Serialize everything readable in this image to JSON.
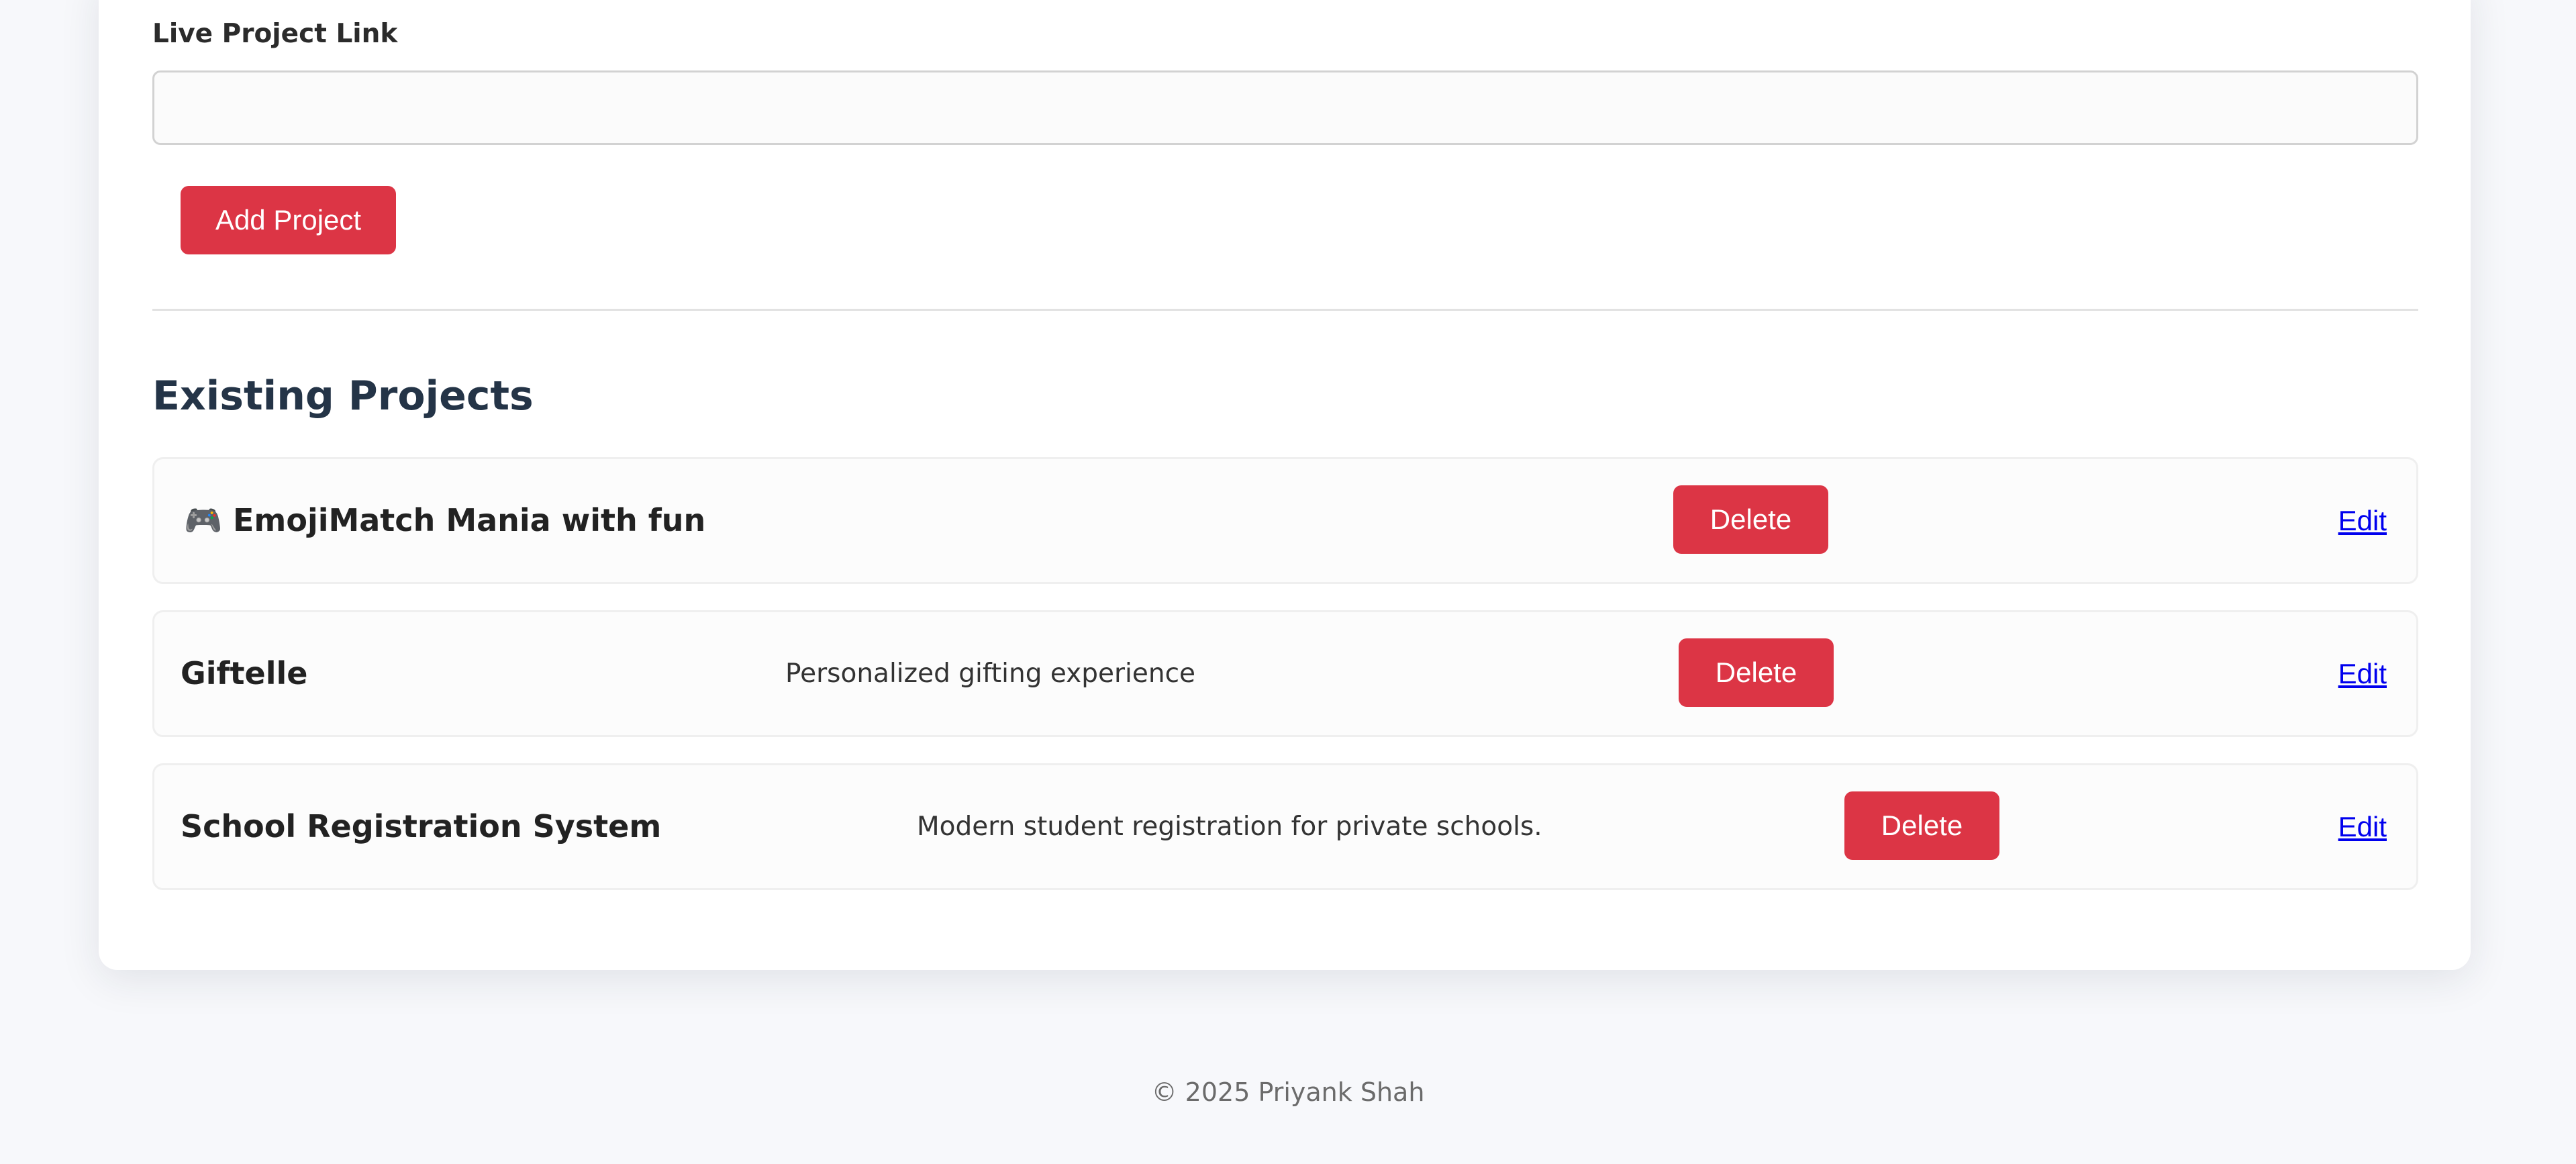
{
  "form": {
    "live_link_label": "Live Project Link",
    "live_link_value": "",
    "add_button_label": "Add Project"
  },
  "existing": {
    "title": "Existing Projects",
    "projects": [
      {
        "emoji": "🎮",
        "name": "EmojiMatch Mania with fun",
        "description": "",
        "delete_label": "Delete",
        "edit_label": "Edit"
      },
      {
        "emoji": "",
        "name": "Giftelle",
        "description": "Personalized gifting experience",
        "delete_label": "Delete",
        "edit_label": "Edit"
      },
      {
        "emoji": "",
        "name": "School Registration System",
        "description": "Modern student registration for private schools.",
        "delete_label": "Delete",
        "edit_label": "Edit"
      }
    ]
  },
  "footer": {
    "copyright": "© 2025 Priyank Shah"
  },
  "colors": {
    "accent_red": "#dc3545",
    "link_blue": "#0000ee",
    "heading": "#243447",
    "page_background": "#f7f8fb"
  }
}
